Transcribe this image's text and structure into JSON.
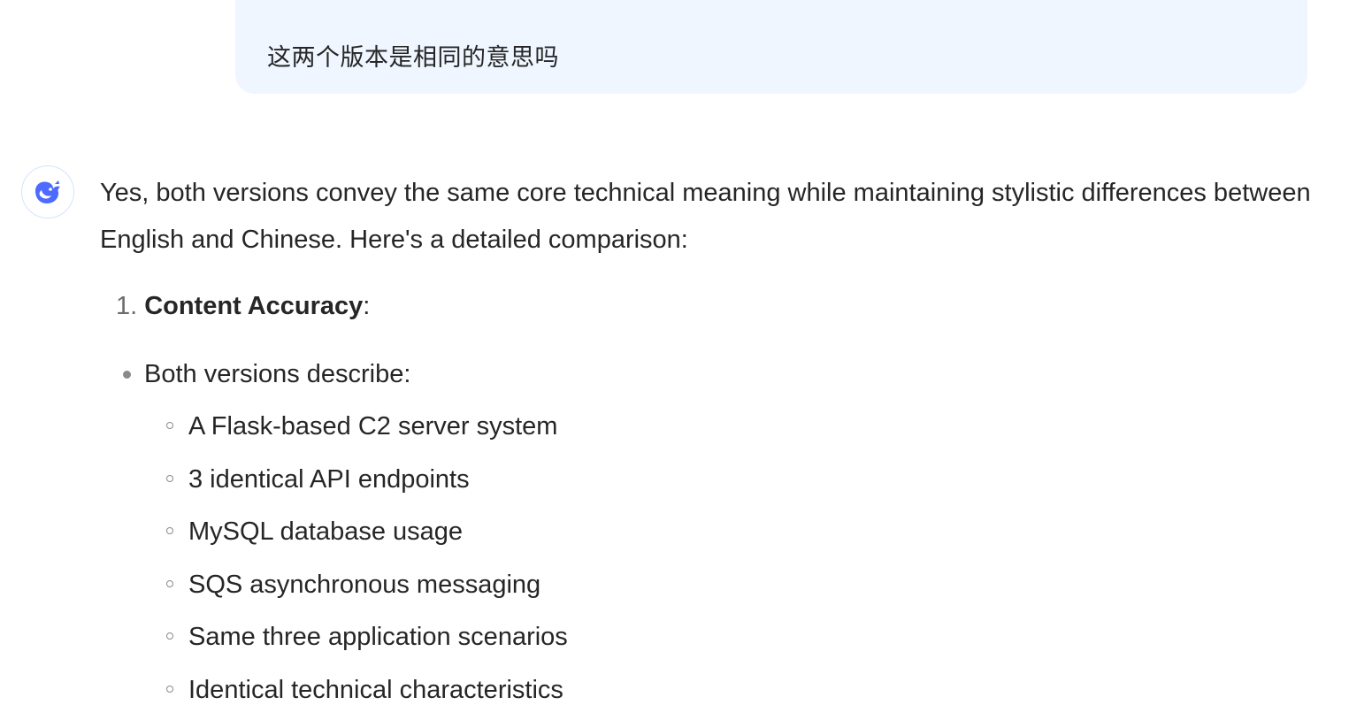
{
  "user_message": {
    "text": "这两个版本是相同的意思吗"
  },
  "assistant": {
    "avatar_icon": "whale-logo-icon",
    "accent_color": "#4d6bfe",
    "intro": "Yes, both versions convey the same core technical meaning while maintaining stylistic differences between English and Chinese. Here's a detailed comparison:",
    "ordered_item": {
      "number": "1.",
      "title": "Content Accuracy",
      "suffix": ":"
    },
    "bullet": "Both versions describe:",
    "sub_items": [
      "A Flask-based C2 server system",
      "3 identical API endpoints",
      "MySQL database usage",
      "SQS asynchronous messaging",
      "Same three application scenarios",
      "Identical technical characteristics"
    ]
  }
}
